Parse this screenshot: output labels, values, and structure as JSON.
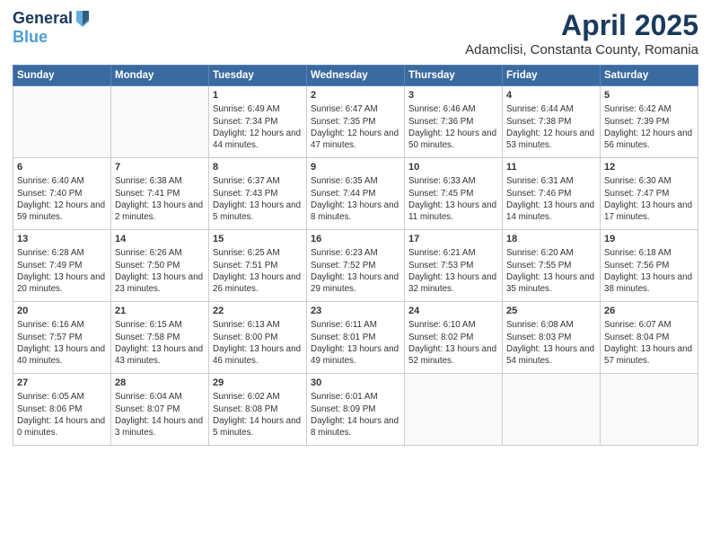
{
  "header": {
    "logo_line1": "General",
    "logo_line2": "Blue",
    "month": "April 2025",
    "location": "Adamclisi, Constanta County, Romania"
  },
  "days_of_week": [
    "Sunday",
    "Monday",
    "Tuesday",
    "Wednesday",
    "Thursday",
    "Friday",
    "Saturday"
  ],
  "weeks": [
    [
      {
        "day": "",
        "info": ""
      },
      {
        "day": "",
        "info": ""
      },
      {
        "day": "1",
        "info": "Sunrise: 6:49 AM\nSunset: 7:34 PM\nDaylight: 12 hours and 44 minutes."
      },
      {
        "day": "2",
        "info": "Sunrise: 6:47 AM\nSunset: 7:35 PM\nDaylight: 12 hours and 47 minutes."
      },
      {
        "day": "3",
        "info": "Sunrise: 6:46 AM\nSunset: 7:36 PM\nDaylight: 12 hours and 50 minutes."
      },
      {
        "day": "4",
        "info": "Sunrise: 6:44 AM\nSunset: 7:38 PM\nDaylight: 12 hours and 53 minutes."
      },
      {
        "day": "5",
        "info": "Sunrise: 6:42 AM\nSunset: 7:39 PM\nDaylight: 12 hours and 56 minutes."
      }
    ],
    [
      {
        "day": "6",
        "info": "Sunrise: 6:40 AM\nSunset: 7:40 PM\nDaylight: 12 hours and 59 minutes."
      },
      {
        "day": "7",
        "info": "Sunrise: 6:38 AM\nSunset: 7:41 PM\nDaylight: 13 hours and 2 minutes."
      },
      {
        "day": "8",
        "info": "Sunrise: 6:37 AM\nSunset: 7:43 PM\nDaylight: 13 hours and 5 minutes."
      },
      {
        "day": "9",
        "info": "Sunrise: 6:35 AM\nSunset: 7:44 PM\nDaylight: 13 hours and 8 minutes."
      },
      {
        "day": "10",
        "info": "Sunrise: 6:33 AM\nSunset: 7:45 PM\nDaylight: 13 hours and 11 minutes."
      },
      {
        "day": "11",
        "info": "Sunrise: 6:31 AM\nSunset: 7:46 PM\nDaylight: 13 hours and 14 minutes."
      },
      {
        "day": "12",
        "info": "Sunrise: 6:30 AM\nSunset: 7:47 PM\nDaylight: 13 hours and 17 minutes."
      }
    ],
    [
      {
        "day": "13",
        "info": "Sunrise: 6:28 AM\nSunset: 7:49 PM\nDaylight: 13 hours and 20 minutes."
      },
      {
        "day": "14",
        "info": "Sunrise: 6:26 AM\nSunset: 7:50 PM\nDaylight: 13 hours and 23 minutes."
      },
      {
        "day": "15",
        "info": "Sunrise: 6:25 AM\nSunset: 7:51 PM\nDaylight: 13 hours and 26 minutes."
      },
      {
        "day": "16",
        "info": "Sunrise: 6:23 AM\nSunset: 7:52 PM\nDaylight: 13 hours and 29 minutes."
      },
      {
        "day": "17",
        "info": "Sunrise: 6:21 AM\nSunset: 7:53 PM\nDaylight: 13 hours and 32 minutes."
      },
      {
        "day": "18",
        "info": "Sunrise: 6:20 AM\nSunset: 7:55 PM\nDaylight: 13 hours and 35 minutes."
      },
      {
        "day": "19",
        "info": "Sunrise: 6:18 AM\nSunset: 7:56 PM\nDaylight: 13 hours and 38 minutes."
      }
    ],
    [
      {
        "day": "20",
        "info": "Sunrise: 6:16 AM\nSunset: 7:57 PM\nDaylight: 13 hours and 40 minutes."
      },
      {
        "day": "21",
        "info": "Sunrise: 6:15 AM\nSunset: 7:58 PM\nDaylight: 13 hours and 43 minutes."
      },
      {
        "day": "22",
        "info": "Sunrise: 6:13 AM\nSunset: 8:00 PM\nDaylight: 13 hours and 46 minutes."
      },
      {
        "day": "23",
        "info": "Sunrise: 6:11 AM\nSunset: 8:01 PM\nDaylight: 13 hours and 49 minutes."
      },
      {
        "day": "24",
        "info": "Sunrise: 6:10 AM\nSunset: 8:02 PM\nDaylight: 13 hours and 52 minutes."
      },
      {
        "day": "25",
        "info": "Sunrise: 6:08 AM\nSunset: 8:03 PM\nDaylight: 13 hours and 54 minutes."
      },
      {
        "day": "26",
        "info": "Sunrise: 6:07 AM\nSunset: 8:04 PM\nDaylight: 13 hours and 57 minutes."
      }
    ],
    [
      {
        "day": "27",
        "info": "Sunrise: 6:05 AM\nSunset: 8:06 PM\nDaylight: 14 hours and 0 minutes."
      },
      {
        "day": "28",
        "info": "Sunrise: 6:04 AM\nSunset: 8:07 PM\nDaylight: 14 hours and 3 minutes."
      },
      {
        "day": "29",
        "info": "Sunrise: 6:02 AM\nSunset: 8:08 PM\nDaylight: 14 hours and 5 minutes."
      },
      {
        "day": "30",
        "info": "Sunrise: 6:01 AM\nSunset: 8:09 PM\nDaylight: 14 hours and 8 minutes."
      },
      {
        "day": "",
        "info": ""
      },
      {
        "day": "",
        "info": ""
      },
      {
        "day": "",
        "info": ""
      }
    ]
  ]
}
